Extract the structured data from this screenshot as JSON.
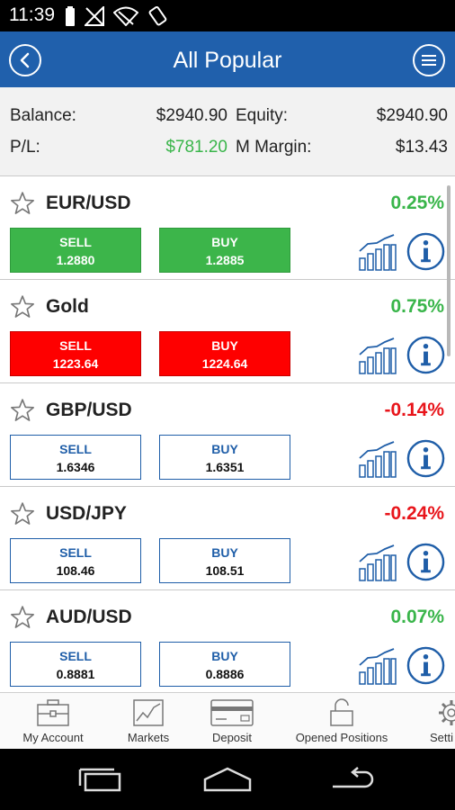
{
  "status_bar": {
    "time": "11:39",
    "icons": [
      "battery-icon",
      "signal-icon",
      "wifi-icon",
      "rotate-icon"
    ]
  },
  "header": {
    "title": "All Popular",
    "back_icon": "back-arrow-icon",
    "menu_icon": "menu-icon"
  },
  "account": {
    "balance_label": "Balance:",
    "balance_value": "$2940.90",
    "equity_label": "Equity:",
    "equity_value": "$2940.90",
    "pl_label": "P/L:",
    "pl_value": "$781.20",
    "margin_label": "M Margin:",
    "margin_value": "$13.43"
  },
  "markets": [
    {
      "name": "EUR/USD",
      "change": "0.25%",
      "direction": "up",
      "sell_label": "SELL",
      "sell_price": "1.2880",
      "buy_label": "BUY",
      "buy_price": "1.2885",
      "button_style": "green"
    },
    {
      "name": "Gold",
      "change": "0.75%",
      "direction": "up",
      "sell_label": "SELL",
      "sell_price": "1223.64",
      "buy_label": "BUY",
      "buy_price": "1224.64",
      "button_style": "red"
    },
    {
      "name": "GBP/USD",
      "change": "-0.14%",
      "direction": "down",
      "sell_label": "SELL",
      "sell_price": "1.6346",
      "buy_label": "BUY",
      "buy_price": "1.6351",
      "button_style": "plain"
    },
    {
      "name": "USD/JPY",
      "change": "-0.24%",
      "direction": "down",
      "sell_label": "SELL",
      "sell_price": "108.46",
      "buy_label": "BUY",
      "buy_price": "108.51",
      "button_style": "plain"
    },
    {
      "name": "AUD/USD",
      "change": "0.07%",
      "direction": "up",
      "sell_label": "SELL",
      "sell_price": "0.8881",
      "buy_label": "BUY",
      "buy_price": "0.8886",
      "button_style": "plain"
    }
  ],
  "bottom_nav": [
    {
      "label": "My Account",
      "icon": "briefcase-icon"
    },
    {
      "label": "Markets",
      "icon": "chart-icon"
    },
    {
      "label": "Deposit",
      "icon": "credit-card-icon"
    },
    {
      "label": "Opened Positions",
      "icon": "lock-icon"
    },
    {
      "label": "Setti",
      "icon": "gear-icon"
    }
  ],
  "colors": {
    "header_blue": "#2060ac",
    "positive_green": "#39b54a",
    "negative_red": "#e8151b",
    "sell_buy_green": "#3cb54a",
    "sell_buy_red": "#fe0000",
    "outline_blue": "#1f5ea8"
  }
}
